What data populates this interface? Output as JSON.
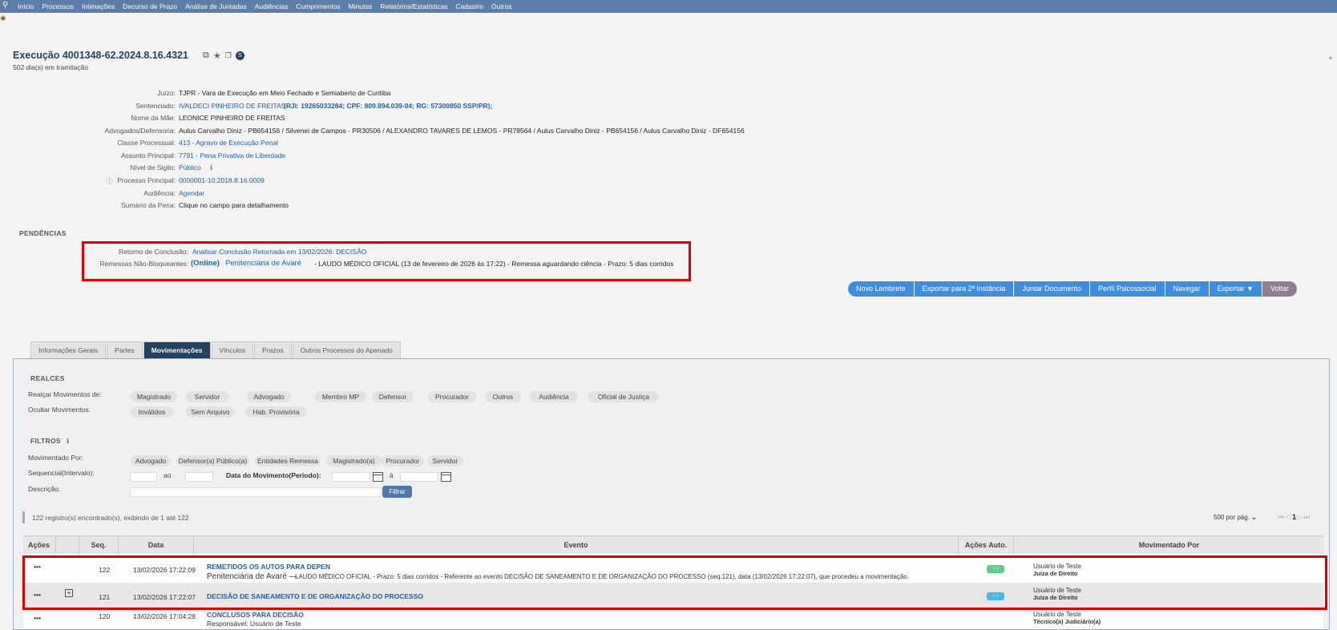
{
  "nav": {
    "search_icon": "search-icon",
    "items": [
      "Início",
      "Processos",
      "Intimações",
      "Decurso de Prazo",
      "Análise de Juntadas",
      "Audiências",
      "Cumprimentos",
      "Minutas",
      "Relatórios/Estatísticas",
      "Cadastro",
      "Outros"
    ]
  },
  "header": {
    "title": "Execução 4001348-62.2024.8.16.4321",
    "subtitle": "502 dia(s) em tramitação",
    "badge": "S"
  },
  "info": [
    {
      "label": "Juízo:",
      "value": "TJPR - Vara de Execução em Meio Fechado e Semiaberto de Curitiba",
      "extra": ""
    },
    {
      "label": "Sentenciado:",
      "value": "IVALDECI PINHEIRO DE FREITAS",
      "extra": "(RJI: 19265033284; CPF: 809.894.039-04; RG: 57300850 SSP/PR);"
    },
    {
      "label": "Nome da Mãe:",
      "value": "LEONICE PINHEIRO DE FREITAS",
      "extra": ""
    },
    {
      "label": "Advogados/Defensoria:",
      "value": "Aulus Carvalho Diniz - PB654156 / Silvenei de Campos - PR30506 / ALEXANDRO TAVARES DE LEMOS - PR78564 / Aulus Carvalho Diniz - PB654156 / Aulus Carvalho Diniz - DF654156",
      "extra": ""
    },
    {
      "label": "Classe Processual:",
      "value": "413 - Agravo de Execução Penal",
      "extra": ""
    },
    {
      "label": "Assunto Principal:",
      "value": "7791 - Pena Privativa de Liberdade",
      "extra": ""
    },
    {
      "label": "Nível de Sigilo:",
      "value": "Público",
      "extra": ""
    },
    {
      "label": "Processo Principal:",
      "value": "0000001-10.2018.8.16.0009",
      "extra": ""
    },
    {
      "label": "Audiência:",
      "value": "Agendar",
      "extra": ""
    },
    {
      "label": "Sumário da Pena:",
      "value": "Clique no campo para detalhamento",
      "extra": ""
    }
  ],
  "pendencias": {
    "title": "PENDÊNCIAS",
    "retorno_label": "Retorno de Conclusão:",
    "retorno_value": "Analisar Conclusão Retornada em 13/02/2026: DECISÃO",
    "remessas_label": "Remessas Não-Bloqueantes:",
    "remessas_online": "(Online)",
    "remessas_dest": "Penitenciária de Avaré",
    "remessas_desc": "- LAUDO MÉDICO OFICIAL (13 de fevereiro de 2026 às 17:22) - Remessa aguardando ciência - Prazo: 5 dias corridos"
  },
  "actions": [
    "Novo Lembrete",
    "Exportar para 2ª Instância",
    "Juntar Documento",
    "Perfil Psicossocial",
    "Navegar",
    "Exportar ▼",
    "Voltar"
  ],
  "tabs": [
    "Informações Gerais",
    "Partes",
    "Movimentações",
    "Vínculos",
    "Prazos",
    "Outros Processos do Apenado"
  ],
  "realces": {
    "title": "REALCES",
    "realcar_label": "Realçar Movimentos de:",
    "realcar": [
      "Magistrado",
      "Servidor",
      "Advogado",
      "Membro MP",
      "Defensor",
      "Procurador",
      "Outros",
      "Audiência",
      "Oficial de Justiça"
    ],
    "ocultar_label": "Ocultar Movimentos:",
    "ocultar": [
      "Inválidos",
      "Sem Arquivo",
      "Hab. Provisória"
    ]
  },
  "filtros": {
    "title": "FILTROS",
    "mov_label": "Movimentado Por:",
    "mov": [
      "Advogado",
      "Defensor(a) Público(a)",
      "Entidades Remessa",
      "Magistrado(a)",
      "Procurador",
      "Servidor"
    ],
    "seq_label": "Sequencial(Intervalo):",
    "ao": "ao",
    "data_label": "Data do Movimento(Período):",
    "a": "à",
    "desc_label": "Descrição:",
    "filtrar": "Filtrar"
  },
  "results": {
    "count": "122 registro(s) encontrado(s), exibindo de 1 até 122",
    "per_page": "500 por pág.",
    "page": "1"
  },
  "table": {
    "headers": [
      "Ações",
      "Seq.",
      "Data",
      "Evento",
      "Ações Auto.",
      "Movimentado Por"
    ],
    "rows": [
      {
        "actions": "•••",
        "seq": "122",
        "date": "13/02/2026 17:22:09",
        "event": "REMETIDOS OS AUTOS PARA DEPEN",
        "detail_dest": "Penitenciária de Avaré —",
        "detail": "LAUDO MÉDICO OFICIAL - Prazo: 5 dias corridos - Referente ao evento DECISÃO DE SANEAMENTO E DE ORGANIZAÇÃO DO PROCESSO (seq.121), data (13/02/2026 17:22:07), que procedeu a movimentação.",
        "user": "Usuário de Teste",
        "role": "Juíza de Direito"
      },
      {
        "actions": "•••",
        "seq": "121",
        "date": "13/02/2026 17:22:07",
        "event": "DECISÃO DE SANEAMENTO E DE ORGANIZAÇÃO DO PROCESSO",
        "detail_dest": "",
        "detail": "",
        "user": "Usuário de Teste",
        "role": "Juíza de Direito"
      },
      {
        "actions": "•••",
        "seq": "120",
        "date": "13/02/2026 17:04:28",
        "event": "CONCLUSOS PARA DECISÃO",
        "detail_dest": "",
        "detail": "Responsável: Usuário de Teste",
        "user": "Usuário de Teste",
        "role": "Técnico(a) Judiciário(a)"
      }
    ]
  },
  "colors": {
    "nav": "#5b7fab",
    "link": "#1f5fa8",
    "highlight": "#e00000",
    "button": "#3b8ee0",
    "voltar": "#8f7d93"
  }
}
